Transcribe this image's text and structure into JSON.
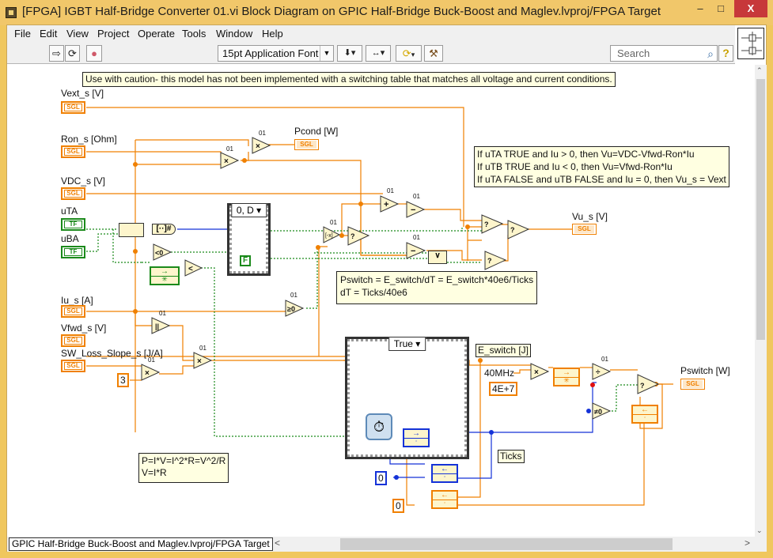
{
  "window": {
    "title": "[FPGA] IGBT Half-Bridge Converter 01.vi Block Diagram on GPIC Half-Bridge Buck-Boost and Maglev.lvproj/FPGA Target",
    "minimize": "–",
    "maximize": "□",
    "close": "X"
  },
  "menu": [
    "File",
    "Edit",
    "View",
    "Project",
    "Operate",
    "Tools",
    "Window",
    "Help"
  ],
  "toolbar": {
    "run_icon": "⇨",
    "run_continuous_icon": "⟳",
    "abort_icon": "●",
    "font": "15pt Application Font",
    "font_dropdown": "▼",
    "align_icon": "⬇",
    "distribute_icon": "↔",
    "reorder_icon": "⟳",
    "cleanup_icon": "⚒",
    "search_placeholder": "Search",
    "search_icon": "⌕",
    "help_icon": "?"
  },
  "notes": {
    "caution": "Use with caution- this model has not been implemented with a switching table that matches all voltage and current conditions.",
    "logic": [
      "If uTA TRUE and Iu > 0, then Vu=VDC-Vfwd-Ron*Iu",
      "If uTB TRUE and Iu < 0, then Vu=Vfwd-Ron*Iu",
      "If uTA FALSE and uTB FALSE and Iu = 0, then Vu_s = Vext"
    ],
    "pswitch": [
      "Pswitch = E_switch/dT = E_switch*40e6/Ticks",
      "dT = Ticks/40e6"
    ],
    "power": [
      "P=I*V=I^2*R=V^2/R",
      "V=I*R"
    ]
  },
  "controls": [
    {
      "label": "Vext_s [V]",
      "type": "SGL"
    },
    {
      "label": "Ron_s [Ohm]",
      "type": "SGL"
    },
    {
      "label": "VDC_s [V]",
      "type": "SGL"
    },
    {
      "label": "uTA",
      "type": "TF"
    },
    {
      "label": "uBA",
      "type": "TF"
    },
    {
      "label": "Iu_s [A]",
      "type": "SGL"
    },
    {
      "label": "Vfwd_s [V]",
      "type": "SGL"
    },
    {
      "label": "SW_Loss_Slope_s [J/A]",
      "type": "SGL"
    }
  ],
  "indicators": [
    {
      "label": "Pcond [W]",
      "type": "SGL"
    },
    {
      "label": "Vu_s [V]",
      "type": "SGL"
    },
    {
      "label": "Pswitch [W]",
      "type": "SGL"
    }
  ],
  "constants": {
    "three": "3",
    "freq_label": "40MHz",
    "freq_value": "4E+7",
    "ticks_init": "0",
    "energy_init": "0",
    "false_const": "F"
  },
  "wire_labels": {
    "e_switch": "E_switch [J]",
    "ticks": "Ticks"
  },
  "structures": {
    "case1_selector": "0, D",
    "case2_selector": "True"
  },
  "functions": {
    "multiply": "×",
    "add": "+",
    "subtract": "−",
    "divide": "÷",
    "negate": "[-x]",
    "less_zero": "<0",
    "less": "<",
    "ge_zero": "≥0",
    "ne_zero": "≠0",
    "abs": "||",
    "or": "∨",
    "precision_label": "01",
    "select": "?"
  },
  "statusbar": {
    "path": "GPIC Half-Bridge Buck-Boost and Maglev.lvproj/FPGA Target",
    "scroll_left": "<",
    "scroll_right": ">"
  },
  "colors": {
    "sgl_wire": "#f08000",
    "bool_wire": "#1b8a1b",
    "int_wire": "#1432d8",
    "note_bg": "#ffffe1",
    "window_border": "#f0c75e",
    "close_button": "#c7383a"
  }
}
